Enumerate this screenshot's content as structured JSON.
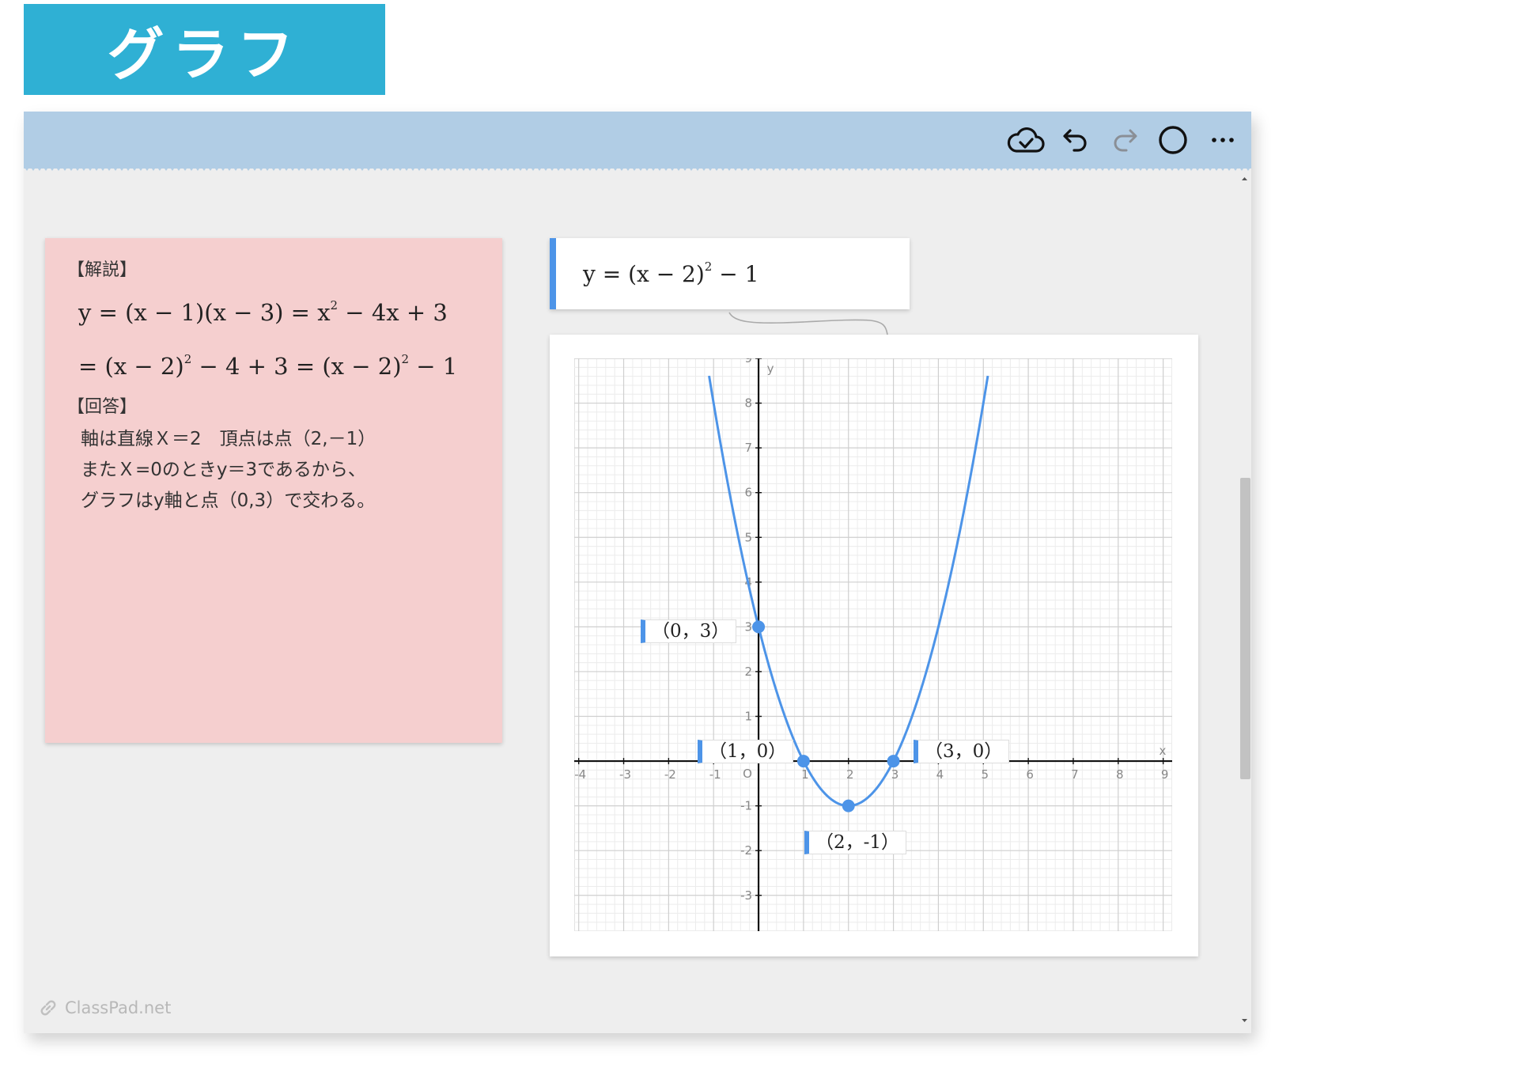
{
  "page": {
    "banner_title": "グラフ"
  },
  "toolbar": {
    "icons": [
      "cloud-check-icon",
      "undo-icon",
      "redo-icon",
      "circle-icon",
      "more-icon"
    ]
  },
  "note": {
    "heading_explanation": "【解説】",
    "math_line1": {
      "lhs": "y = (x − 1)(x − 3) = x",
      "sup": "2",
      "rhs": " − 4x + 3"
    },
    "math_line2": {
      "part1": "= (x − 2)",
      "sup1": "2",
      "part2": " − 4 + 3 = (x − 2)",
      "sup2": "2",
      "part3": " − 1"
    },
    "heading_answer": "【回答】",
    "answer_lines": [
      "軸は直線Ｘ＝2　頂点は点（2,－1）",
      "またＸ=0のときy＝3であるから、",
      "グラフはy軸と点（0,3）で交わる。"
    ]
  },
  "equation": {
    "prefix": "y = (x − 2)",
    "sup": "2",
    "suffix": " − 1"
  },
  "graph": {
    "axis_x_label": "x",
    "axis_y_label": "y",
    "origin_label": "O",
    "x_ticks": [
      "-4",
      "-3",
      "-2",
      "-1",
      "1",
      "2",
      "3",
      "4",
      "5",
      "6",
      "7",
      "8",
      "9"
    ],
    "y_ticks": [
      "-3",
      "-2",
      "-1",
      "1",
      "2",
      "3",
      "4",
      "5",
      "6",
      "7",
      "8",
      "9"
    ],
    "point_labels": [
      "（0，3）",
      "（1，0）",
      "（3，0）",
      "（2，-1）"
    ],
    "curve_color": "#4d94e8"
  },
  "chart_data": {
    "type": "line",
    "title": "",
    "xlabel": "x",
    "ylabel": "y",
    "xlim": [
      -4.1,
      9.2
    ],
    "ylim": [
      -3.8,
      9
    ],
    "grid": true,
    "series": [
      {
        "name": "y = (x − 2)² − 1",
        "function": "(x-2)^2-1",
        "x_range": [
          -1.1,
          5.1
        ]
      }
    ],
    "points": [
      {
        "x": 0,
        "y": 3,
        "label": "（0，3）"
      },
      {
        "x": 1,
        "y": 0,
        "label": "（1，0）"
      },
      {
        "x": 3,
        "y": 0,
        "label": "（3，0）"
      },
      {
        "x": 2,
        "y": -1,
        "label": "（2，-1）"
      }
    ]
  },
  "branding": {
    "watermark": "ClassPad.net"
  }
}
